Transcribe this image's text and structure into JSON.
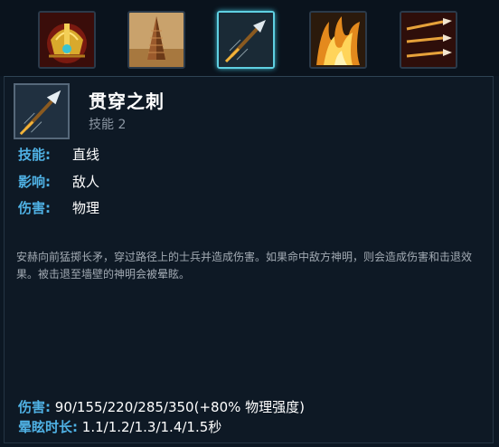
{
  "abilities": [
    {
      "icon": "golden-helm-icon",
      "selected": false
    },
    {
      "icon": "obelisk-icon",
      "selected": false
    },
    {
      "icon": "spear-thrust-icon",
      "selected": true
    },
    {
      "icon": "flame-burst-icon",
      "selected": false
    },
    {
      "icon": "triple-spear-icon",
      "selected": false
    }
  ],
  "skill": {
    "title": "贯穿之刺",
    "subtitle": "技能 2",
    "attributes": [
      {
        "label": "技能:",
        "value": "直线"
      },
      {
        "label": "影响:",
        "value": "敌人"
      },
      {
        "label": "伤害:",
        "value": "物理"
      }
    ],
    "description": "安赫向前猛掷长矛，穿过路径上的士兵并造成伤害。如果命中敌方神明，则会造成伤害和击退效果。被击退至墙壁的神明会被晕眩。",
    "stats": [
      {
        "label": "伤害:",
        "value": "90/155/220/285/350(+80% 物理强度)"
      },
      {
        "label": "晕眩时长:",
        "value": "1.1/1.2/1.3/1.4/1.5秒"
      }
    ]
  },
  "colors": {
    "accent": "#4fb1e4",
    "selected_border": "#5fd0e2",
    "background": "#0c1723"
  }
}
